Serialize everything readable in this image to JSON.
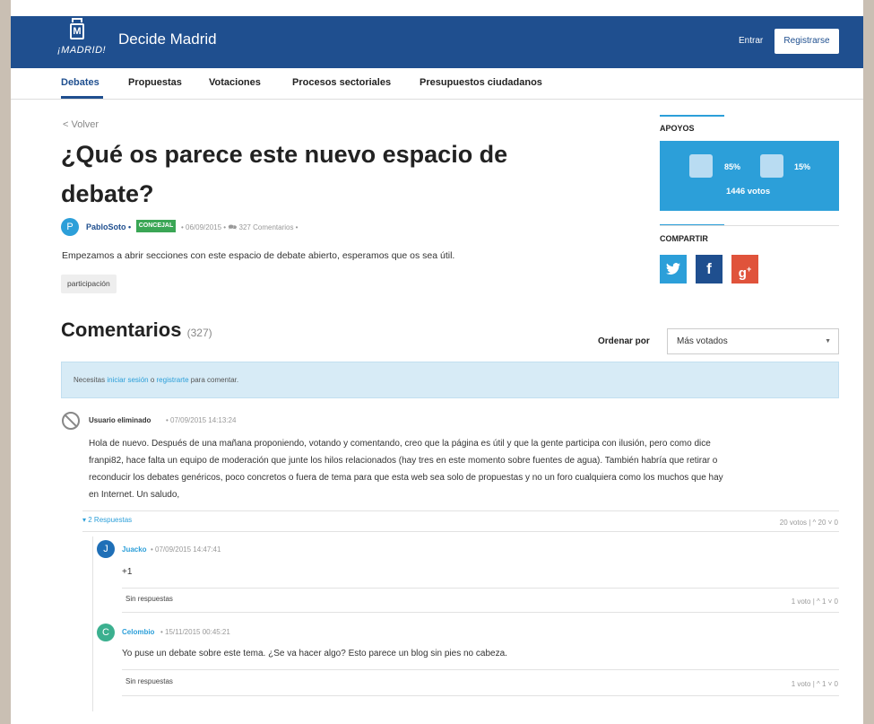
{
  "header": {
    "logo_text": "¡MADRID!",
    "site_title": "Decide Madrid",
    "login_label": "Entrar",
    "register_label": "Registrarse"
  },
  "nav": {
    "items": [
      "Debates",
      "Propuestas",
      "Votaciones",
      "Procesos sectoriales",
      "Presupuestos ciudadanos"
    ],
    "active": "Debates"
  },
  "debate": {
    "back_label": "< Volver",
    "title": "¿Qué os parece este nuevo espacio de debate?",
    "author_initial": "P",
    "author": "PabloSoto",
    "badge": "CONCEJAL",
    "date": "06/09/2015",
    "comments_count": "327 Comentarios",
    "body": "Empezamos a abrir secciones con este espacio de debate abierto, esperamos que os sea útil.",
    "tag": "participación"
  },
  "sidebar": {
    "supports_heading": "APOYOS",
    "in_favor_pct": "85%",
    "against_pct": "15%",
    "total_votes": "1446 votos",
    "share_heading": "COMPARTIR",
    "share_buttons": [
      "twitter",
      "facebook",
      "google-plus"
    ],
    "colors": {
      "twitter": "#2c9fd9",
      "facebook": "#1f4f8f",
      "google-plus": "#e0533b",
      "support_box": "#2c9fd9"
    }
  },
  "comments_section": {
    "heading": "Comentarios",
    "count": "(327)",
    "order_label": "Ordenar por",
    "order_value": "Más votados",
    "notice_prefix": "Necesitas ",
    "notice_login": "iniciar sesión",
    "notice_middle": " o ",
    "notice_register": "registrarte",
    "notice_suffix": " para comentar."
  },
  "comments": [
    {
      "user": "Usuario eliminado",
      "date": "• 07/09/2015 14:13:24",
      "lines": [
        "Hola de nuevo. Después de una mañana proponiendo, votando y comentando, creo que la página es útil y que la gente participa con ilusión, pero como dice",
        "franpi82, hace falta un equipo de moderación que junte los hilos relacionados (hay tres en este momento sobre fuentes de agua). También habría que retirar o",
        "reconducir los debates genéricos, poco concretos o fuera de tema para que esta web sea solo de propuestas y no un foro cualquiera como los muchos que hay",
        "en Internet. Un saludo,"
      ],
      "replies_label": "2 Respuestas",
      "votes": "20 votos  |  ^ 20  ˅ 0"
    }
  ],
  "replies": [
    {
      "initial": "J",
      "avatar_color": "#1f6fb7",
      "user": "Juacko",
      "date": "• 07/09/2015 14:47:41",
      "text": "+1",
      "no_replies": "Sin respuestas",
      "votes": "1 voto  |  ^ 1  ˅ 0"
    },
    {
      "initial": "C",
      "avatar_color": "#3bb08f",
      "user": "Celombio",
      "date": "• 15/11/2015 00:45:21",
      "text": "Yo puse un debate sobre este tema. ¿Se va hacer algo? Esto parece un blog sin pies no cabeza.",
      "no_replies": "Sin respuestas",
      "votes": "1 voto  |  ^ 1  ˅ 0"
    }
  ]
}
